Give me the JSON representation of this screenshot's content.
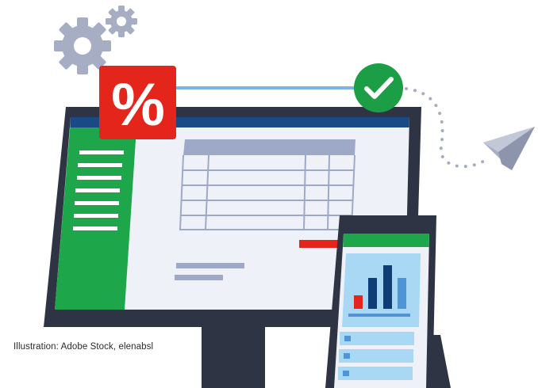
{
  "illustration": {
    "badge_symbol": "%",
    "icons": [
      "gear-icon",
      "gear-icon",
      "percent-badge",
      "checkmark-icon",
      "paper-plane-icon",
      "bar-chart-icon"
    ],
    "credit": "Illustration: Adobe Stock, elenabsl"
  },
  "colors": {
    "monitor_frame": "#2f3445",
    "sidebar_green": "#1ea64a",
    "header_blue": "#1a4a86",
    "screen_bg": "#eef2f8",
    "table_header": "#9ea9c8",
    "accent_red": "#e3251b",
    "check_green": "#1b9e45",
    "gear_gray": "#a7aec3",
    "chart_dark": "#0f3d75",
    "chart_mid": "#2a74b8",
    "chart_light": "#4f95d6",
    "chart_panel": "#a9d8f5"
  }
}
